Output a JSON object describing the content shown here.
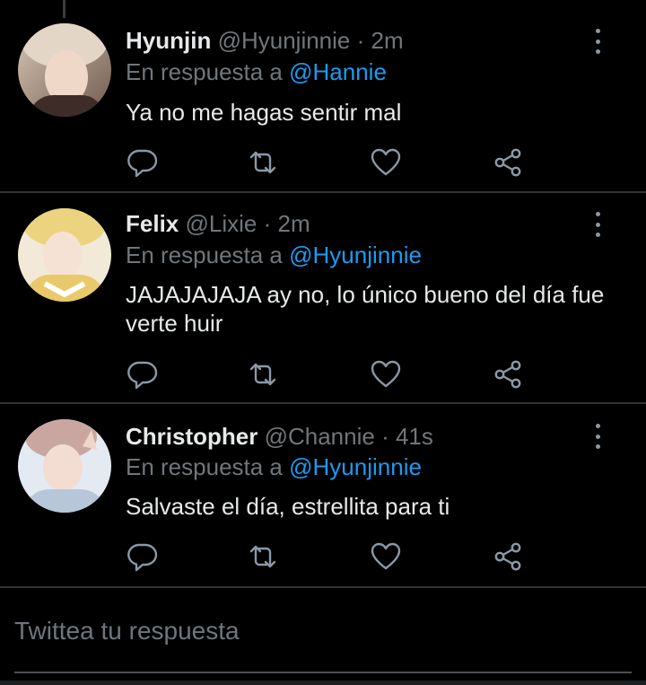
{
  "tweets": [
    {
      "name": "Hyunjin",
      "handle": "@Hyunjinnie",
      "separator": "·",
      "time": "2m",
      "reply_prefix": "En respuesta a",
      "reply_to": "@Hannie",
      "text": "Ya no me hagas sentir mal",
      "avatar_colors": [
        "#cdb9a8",
        "#8a6f5e"
      ]
    },
    {
      "name": "Felix",
      "handle": "@Lixie",
      "separator": "·",
      "time": "2m",
      "reply_prefix": "En respuesta a",
      "reply_to": "@Hyunjinnie",
      "text": "JAJAJAJAJA ay no, lo único bueno del día fue verte huir",
      "avatar_colors": [
        "#e9cf7a",
        "#f4efe2"
      ]
    },
    {
      "name": "Christopher",
      "handle": "@Channie",
      "separator": "·",
      "time": "41s",
      "reply_prefix": "En respuesta a",
      "reply_to": "@Hyunjinnie",
      "text": "Salvaste el día, estrellita para ti",
      "avatar_colors": [
        "#dde5ee",
        "#a8b7c8"
      ]
    }
  ],
  "icons": {
    "reply": "reply-icon",
    "retweet": "retweet-icon",
    "like": "heart-icon",
    "share": "share-icon",
    "more": "more-vertical-icon"
  },
  "compose": {
    "placeholder": "Twittea tu respuesta"
  },
  "colors": {
    "background": "#000000",
    "text": "#e7e9ea",
    "secondary": "#71767b",
    "accent": "#1d9bf0",
    "divider": "#2f3336"
  }
}
